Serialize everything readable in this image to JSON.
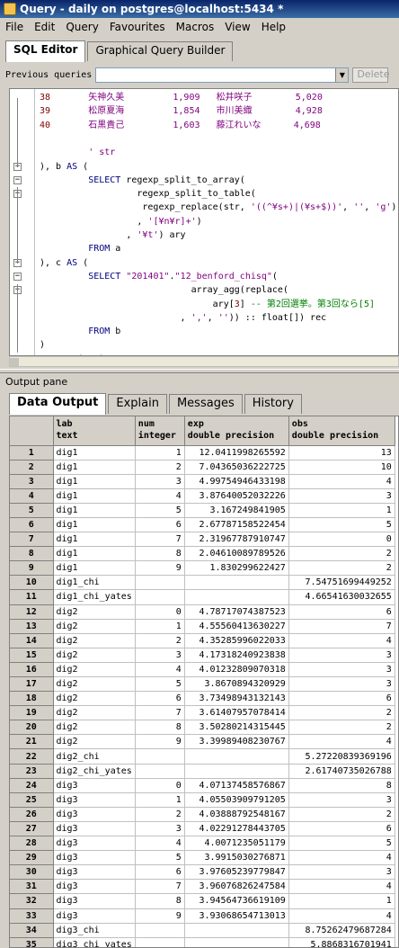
{
  "window": {
    "title": "Query - daily on postgres@localhost:5434 *"
  },
  "menu": [
    "File",
    "Edit",
    "Query",
    "Favourites",
    "Macros",
    "View",
    "Help"
  ],
  "top_tabs": [
    "SQL Editor",
    "Graphical Query Builder"
  ],
  "previous_queries": {
    "label": "Previous queries",
    "value": "",
    "delete_label": "Delete"
  },
  "editor_lines": [
    {
      "html": "<span class=\"num\">38</span>       <span class=\"str\">矢神久美</span>         <span class=\"str\">1,909</span>   <span class=\"str\">松井咲子</span>        <span class=\"str\">5,020</span>"
    },
    {
      "html": "<span class=\"num\">39</span>       <span class=\"str\">松原夏海</span>         <span class=\"str\">1,854</span>   <span class=\"str\">市川美織</span>        <span class=\"str\">4,928</span>"
    },
    {
      "html": "<span class=\"num\">40</span>       <span class=\"str\">石黒貴己</span>         <span class=\"str\">1,603</span>   <span class=\"str\">藤江れいな</span>      <span class=\"str\">4,698</span>"
    },
    {
      "html": ""
    },
    {
      "html": "         <span class=\"str\">' str</span>"
    },
    {
      "html": "), b <span class=\"kw\">AS</span> ("
    },
    {
      "html": "         <span class=\"kw\">SELECT</span> regexp_split_to_array("
    },
    {
      "html": "                  regexp_split_to_table("
    },
    {
      "html": "                   regexp_replace(str, <span class=\"str\">'((^¥s+)|(¥s+$))'</span>, <span class=\"str\">''</span>, <span class=\"str\">'g'</span>)"
    },
    {
      "html": "                  , <span class=\"str\">'[¥n¥r]+'</span>)"
    },
    {
      "html": "                , <span class=\"str\">'¥t'</span>) ary"
    },
    {
      "html": "         <span class=\"kw\">FROM</span> a"
    },
    {
      "html": "), c <span class=\"kw\">AS</span> ("
    },
    {
      "html": "         <span class=\"kw\">SELECT</span> <span class=\"str\">\"201401\"</span>.<span class=\"str\">\"12_benford_chisq\"</span>("
    },
    {
      "html": "                            array_agg(replace("
    },
    {
      "html": "                                ary[<span class=\"num\">3</span>] <span class=\"cmt\">-- 第2回選挙。第3回なら[5]</span>"
    },
    {
      "html": "                          , <span class=\"str\">','</span>, <span class=\"str\">''</span>)) :: float[]) rec"
    },
    {
      "html": "         <span class=\"kw\">FROM</span> b"
    },
    {
      "html": ")"
    },
    {
      "html": "<span class=\"kw\">SELECT</span> (rec).* <span class=\"kw\">FROM</span> c ;"
    }
  ],
  "output_pane": {
    "label": "Output pane",
    "tabs": [
      "Data Output",
      "Explain",
      "Messages",
      "History"
    ]
  },
  "columns": [
    {
      "name": "lab",
      "type": "text"
    },
    {
      "name": "num",
      "type": "integer"
    },
    {
      "name": "exp",
      "type": "double precision"
    },
    {
      "name": "obs",
      "type": "double precision"
    }
  ],
  "rows": [
    [
      "1",
      "dig1",
      "1",
      "12.0411998265592",
      "13"
    ],
    [
      "2",
      "dig1",
      "2",
      "7.04365036222725",
      "10"
    ],
    [
      "3",
      "dig1",
      "3",
      "4.99754946433198",
      "4"
    ],
    [
      "4",
      "dig1",
      "4",
      "3.87640052032226",
      "3"
    ],
    [
      "5",
      "dig1",
      "5",
      "3.167249841905",
      "1"
    ],
    [
      "6",
      "dig1",
      "6",
      "2.67787158522454",
      "5"
    ],
    [
      "7",
      "dig1",
      "7",
      "2.31967787910747",
      "0"
    ],
    [
      "8",
      "dig1",
      "8",
      "2.04610089789526",
      "2"
    ],
    [
      "9",
      "dig1",
      "9",
      "1.830299622427",
      "2"
    ],
    [
      "10",
      "dig1_chi",
      "",
      "",
      "7.54751699449252"
    ],
    [
      "11",
      "dig1_chi_yates",
      "",
      "",
      "4.66541630032655"
    ],
    [
      "12",
      "dig2",
      "0",
      "4.78717074387523",
      "6"
    ],
    [
      "13",
      "dig2",
      "1",
      "4.55560413630227",
      "7"
    ],
    [
      "14",
      "dig2",
      "2",
      "4.35285996022033",
      "4"
    ],
    [
      "15",
      "dig2",
      "3",
      "4.17318240923838",
      "3"
    ],
    [
      "16",
      "dig2",
      "4",
      "4.01232809070318",
      "3"
    ],
    [
      "17",
      "dig2",
      "5",
      "3.8670894320929",
      "3"
    ],
    [
      "18",
      "dig2",
      "6",
      "3.73498943132143",
      "6"
    ],
    [
      "19",
      "dig2",
      "7",
      "3.61407957078414",
      "2"
    ],
    [
      "20",
      "dig2",
      "8",
      "3.50280214315445",
      "2"
    ],
    [
      "21",
      "dig2",
      "9",
      "3.39989408230767",
      "4"
    ],
    [
      "22",
      "dig2_chi",
      "",
      "",
      "5.27220839369196"
    ],
    [
      "23",
      "dig2_chi_yates",
      "",
      "",
      "2.61740735026788"
    ],
    [
      "24",
      "dig3",
      "0",
      "4.07137458576867",
      "8"
    ],
    [
      "25",
      "dig3",
      "1",
      "4.05503909791205",
      "3"
    ],
    [
      "26",
      "dig3",
      "2",
      "4.03888792548167",
      "2"
    ],
    [
      "27",
      "dig3",
      "3",
      "4.02291278443705",
      "6"
    ],
    [
      "28",
      "dig3",
      "4",
      "4.0071235051179",
      "5"
    ],
    [
      "29",
      "dig3",
      "5",
      "3.9915030276871",
      "4"
    ],
    [
      "30",
      "dig3",
      "6",
      "3.97605239779847",
      "3"
    ],
    [
      "31",
      "dig3",
      "7",
      "3.96076826247584",
      "4"
    ],
    [
      "32",
      "dig3",
      "8",
      "3.94564736619109",
      "1"
    ],
    [
      "33",
      "dig3",
      "9",
      "3.93068654713013",
      "4"
    ],
    [
      "34",
      "dig3_chi",
      "",
      "",
      "8.75262479687284"
    ],
    [
      "35",
      "dig3_chi_yates",
      "",
      "",
      "5.8868316701941"
    ]
  ]
}
